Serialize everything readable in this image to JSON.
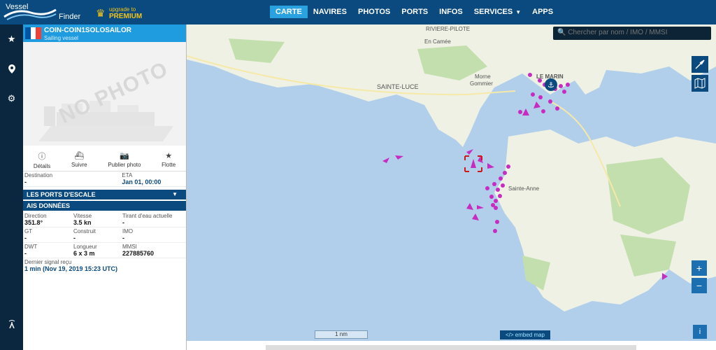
{
  "brand": {
    "line1": "Vessel",
    "line2": "Finder"
  },
  "premium": {
    "line1": "upgrade to",
    "line2": "PREMIUM"
  },
  "nav": [
    {
      "label": "CARTE",
      "active": true
    },
    {
      "label": "NAVIRES"
    },
    {
      "label": "PHOTOS"
    },
    {
      "label": "PORTS"
    },
    {
      "label": "INFOS"
    },
    {
      "label": "SERVICES"
    },
    {
      "label": "APPS"
    }
  ],
  "rail": {
    "top": [
      "star-icon",
      "map-pin-icon",
      "gear-icon"
    ],
    "bottom": "antenna-icon"
  },
  "vessel": {
    "name": "COIN-COIN1SOLOSAILOR",
    "type": "Sailing vessel",
    "flag_colors": [
      "#0055a4",
      "#ffffff",
      "#ef4135"
    ],
    "no_photo": "NO PHOTO"
  },
  "actions": [
    {
      "label": "Détails",
      "icon": "info-icon"
    },
    {
      "label": "Suivre",
      "icon": "ship-icon"
    },
    {
      "label": "Publier photo",
      "icon": "camera-icon"
    },
    {
      "label": "Flotte",
      "icon": "star-icon"
    }
  ],
  "voyage": {
    "destination_label": "Destination",
    "destination": "-",
    "eta_label": "ETA",
    "eta": "Jan 01, 00:00"
  },
  "sections": {
    "ports": "LES PORTS D'ESCALE",
    "ais": "AIS DONNÉES"
  },
  "ais": {
    "rows": [
      {
        "l1": "Direction",
        "v1": "351.8°",
        "l2": "Vitesse",
        "v2": "3.5 kn",
        "l3": "Tirant d'eau actuelle",
        "v3": "-"
      },
      {
        "l1": "GT",
        "v1": "-",
        "l2": "Construit",
        "v2": "-",
        "l3": "IMO",
        "v3": "-"
      },
      {
        "l1": "DWT",
        "v1": "-",
        "l2": "Longueur",
        "v2": "6 x 3 m",
        "l3": "MMSI",
        "v3": "227885760"
      }
    ],
    "last_signal_label": "Dernier signal reçu",
    "last_signal": "1 min (Nov 19, 2019 15:23 UTC)"
  },
  "map": {
    "search_placeholder": "Chercher par nom / IMO / MMSI",
    "places": {
      "riviere_pilote": "RIVIERE-PILOTE",
      "en_camee": "En Camée",
      "sainte_luce": "SAINTE-LUCE",
      "mome": "Morne",
      "gommier": "Gommier",
      "le_marin": "LE MARIN",
      "sainte_anne": "Sainte-Anne"
    },
    "scale": "1 nm",
    "embed": "</> embed map",
    "zoom_in": "+",
    "zoom_out": "−",
    "info": "i",
    "colors": {
      "sea": "#b1cfeb",
      "land": "#eef1e4",
      "green": "#c4dfae",
      "vessel": "#c82bc0"
    }
  }
}
